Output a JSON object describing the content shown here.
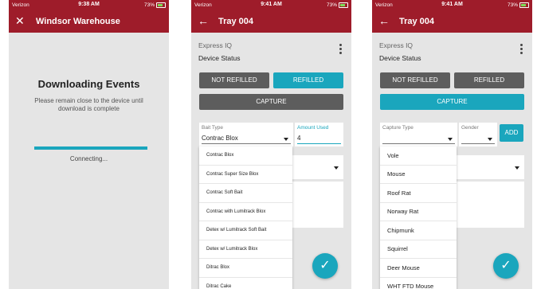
{
  "screens": [
    {
      "status": {
        "carrier": "Verizon",
        "time": "9:38 AM",
        "battery": "73%"
      },
      "appbar": {
        "title": "Windsor Warehouse",
        "nav_icon": "close-icon"
      },
      "download": {
        "title": "Downloading Events",
        "message": "Please remain close to the device until download is complete",
        "progress": 1.0,
        "status_text": "Connecting..."
      }
    },
    {
      "status": {
        "carrier": "Verizon",
        "time": "9:41 AM",
        "battery": "73%"
      },
      "appbar": {
        "title": "Tray 004",
        "nav_icon": "back-arrow-icon"
      },
      "header": {
        "line1": "Express IQ",
        "line2": "Device Status"
      },
      "buttons": {
        "not_refilled": "NOT REFILLED",
        "refilled": "REFILLED",
        "capture": "CAPTURE"
      },
      "bait_type": {
        "label": "Bait Type",
        "value": "Contrac Blox"
      },
      "amount_used": {
        "label": "Amount Used",
        "value": "4"
      },
      "dropdown": [
        "Contrac Blox",
        "Contrac Super Size Blox",
        "Contrac Soft Bait",
        "Contrac with Lumitrack Blox",
        "Detex  w/ Lumitrack Soft Bait",
        "Detex w/ Lumitrack Blox",
        "Ditrac Blox",
        "Ditrac Cake"
      ],
      "fab_icon": "check-icon",
      "colors": {
        "selected_button": "#1aa6bd",
        "unselected_button": "#5d5d5d"
      }
    },
    {
      "status": {
        "carrier": "Verizon",
        "time": "9:41 AM",
        "battery": "73%"
      },
      "appbar": {
        "title": "Tray 004",
        "nav_icon": "back-arrow-icon"
      },
      "header": {
        "line1": "Express IQ",
        "line2": "Device Status"
      },
      "buttons": {
        "not_refilled": "NOT REFILLED",
        "refilled": "REFILLED",
        "capture": "CAPTURE",
        "add": "ADD"
      },
      "capture_type": {
        "label": "Capture Type",
        "value": ""
      },
      "gender": {
        "label": "Gender",
        "value": ""
      },
      "dropdown": [
        "Vole",
        "Mouse",
        "Roof Rat",
        "Norway Rat",
        "Chipmunk",
        "Squirrel",
        "Deer Mouse",
        "WHT FTD Mouse"
      ],
      "fab_icon": "check-icon"
    }
  ],
  "colors": {
    "appbar": "#9e1c2a",
    "accent": "#1aa6bd",
    "background": "#e5e5e5"
  }
}
